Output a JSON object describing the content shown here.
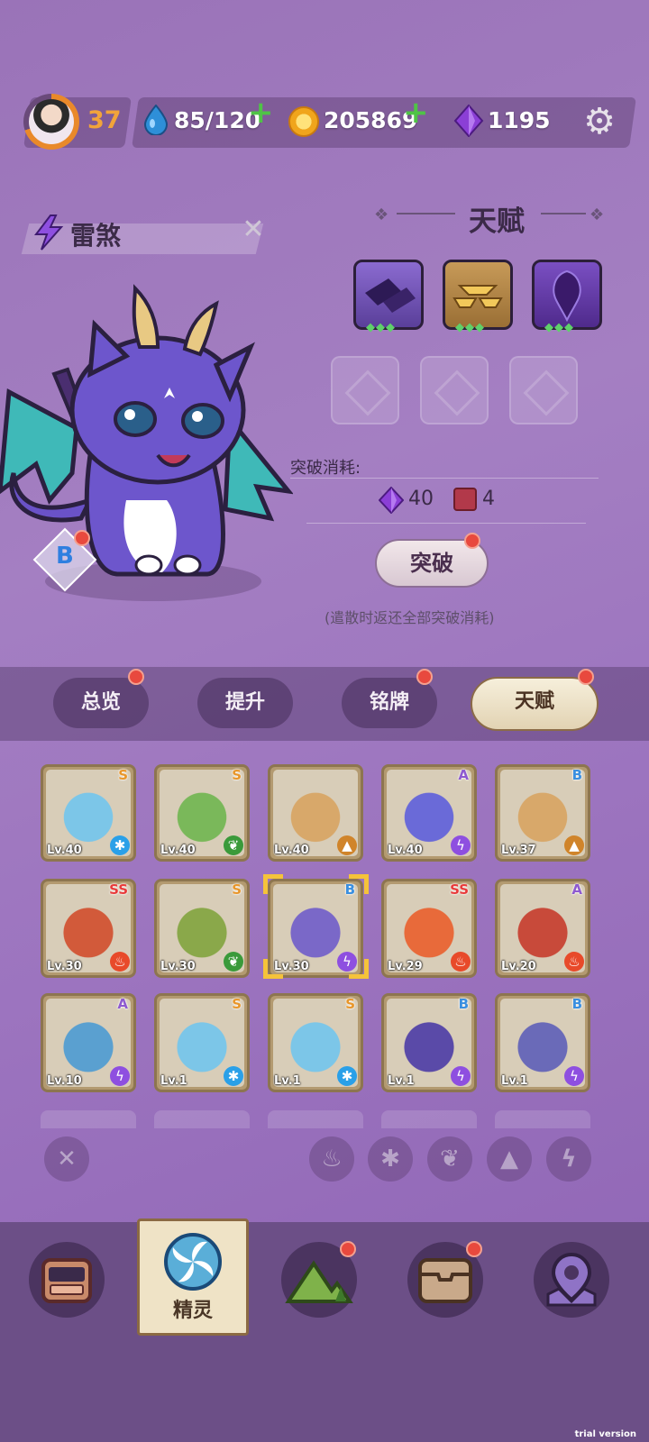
{
  "topbar": {
    "level": "37",
    "energy": "85/120",
    "coins": "205869",
    "gems": "1195",
    "icons": [
      "avatar",
      "water-drop-icon",
      "plus-icon",
      "coin-icon",
      "plus-icon",
      "gem-icon",
      "gear-icon"
    ]
  },
  "pet": {
    "name": "雷煞",
    "rank": "B",
    "element_icon": "lightning-icon"
  },
  "talent": {
    "title": "天赋",
    "icons": [
      "purple-tiles-talent-icon",
      "gold-bowls-talent-icon",
      "purple-drop-talent-icon"
    ],
    "cost_label": "突破消耗:",
    "cost_gem": "40",
    "cost_book": "4",
    "break_button": "突破",
    "note": "(遣散时返还全部突破消耗)"
  },
  "tabs": [
    {
      "label": "总览",
      "badge": true
    },
    {
      "label": "提升",
      "badge": false
    },
    {
      "label": "铭牌",
      "badge": true
    },
    {
      "label": "天赋",
      "badge": true,
      "active": true
    }
  ],
  "grid": [
    {
      "lv": "Lv.40",
      "rank": "S",
      "rank_color": "#e8962a",
      "element": "ice",
      "art": "#7cc6e8"
    },
    {
      "lv": "Lv.40",
      "rank": "S",
      "rank_color": "#e8962a",
      "element": "leaf",
      "art": "#7ab85a"
    },
    {
      "lv": "Lv.40",
      "rank": "",
      "rank_color": "#e8962a",
      "element": "rock",
      "art": "#d8a86a"
    },
    {
      "lv": "Lv.40",
      "rank": "A",
      "rank_color": "#8e5ad0",
      "element": "bolt",
      "art": "#6a6ad8"
    },
    {
      "lv": "Lv.37",
      "rank": "B",
      "rank_color": "#3a8fe0",
      "element": "rock",
      "art": "#d8a86a"
    },
    {
      "lv": "Lv.30",
      "rank": "SS",
      "rank_color": "#e83a3a",
      "element": "fire",
      "art": "#d25a3a"
    },
    {
      "lv": "Lv.30",
      "rank": "S",
      "rank_color": "#e8962a",
      "element": "leaf",
      "art": "#8aa84a"
    },
    {
      "lv": "Lv.30",
      "rank": "B",
      "rank_color": "#3a8fe0",
      "element": "bolt",
      "art": "#7a68c8"
    },
    {
      "lv": "Lv.29",
      "rank": "SS",
      "rank_color": "#e83a3a",
      "element": "fire",
      "art": "#e86a3a"
    },
    {
      "lv": "Lv.20",
      "rank": "A",
      "rank_color": "#8e5ad0",
      "element": "fire",
      "art": "#c84a3a"
    },
    {
      "lv": "Lv.10",
      "rank": "A",
      "rank_color": "#8e5ad0",
      "element": "bolt",
      "art": "#5aa0d0"
    },
    {
      "lv": "Lv.1",
      "rank": "S",
      "rank_color": "#e8962a",
      "element": "ice",
      "art": "#7cc6e8"
    },
    {
      "lv": "Lv.1",
      "rank": "S",
      "rank_color": "#e8962a",
      "element": "ice",
      "art": "#7cc6e8"
    },
    {
      "lv": "Lv.1",
      "rank": "B",
      "rank_color": "#3a8fe0",
      "element": "bolt",
      "art": "#5a4aa8"
    },
    {
      "lv": "Lv.1",
      "rank": "B",
      "rank_color": "#3a8fe0",
      "element": "bolt",
      "art": "#6a6ab8"
    }
  ],
  "filters": [
    "close-filter-icon",
    "fire-filter-icon",
    "ice-filter-icon",
    "leaf-filter-icon",
    "rock-filter-icon",
    "bolt-filter-icon"
  ],
  "nav": {
    "active_label": "精灵",
    "items": [
      "backpack-nav-icon",
      "spirit-nav-icon",
      "mountain-nav-icon",
      "chest-nav-icon",
      "map-pin-nav-icon"
    ]
  },
  "watermark": "trial version",
  "colors": {
    "accent": "#f2a43a",
    "plus": "#4fc346",
    "badge": "#e8493e",
    "panel": "#a47fc2"
  }
}
